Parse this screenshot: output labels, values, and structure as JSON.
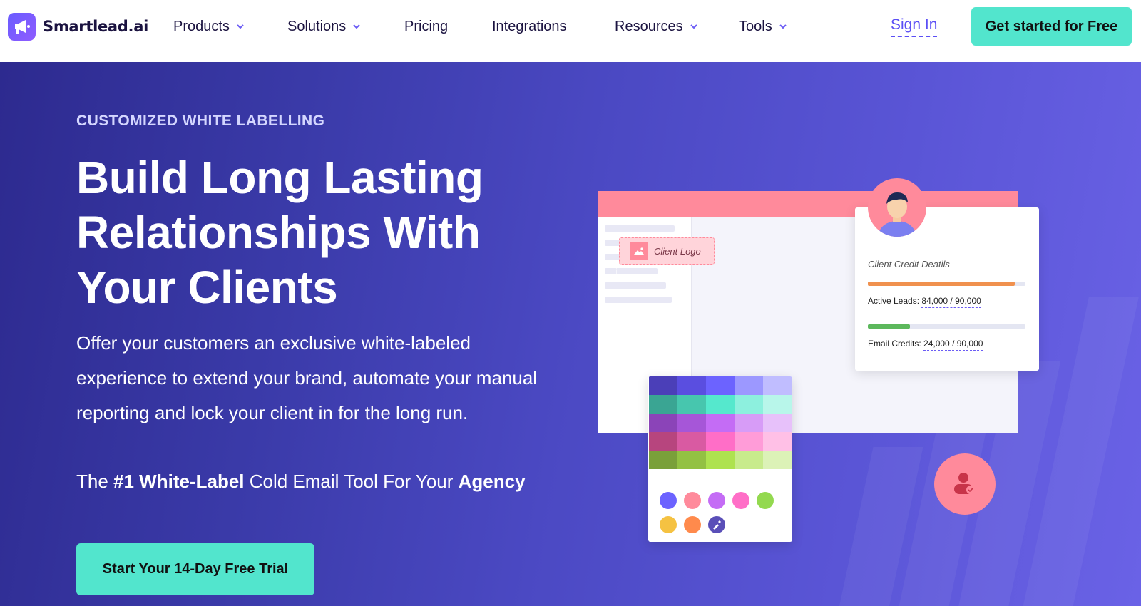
{
  "nav": {
    "brand": "Smartlead.ai",
    "items": [
      {
        "label": "Products",
        "dropdown": true
      },
      {
        "label": "Solutions",
        "dropdown": true
      },
      {
        "label": "Pricing",
        "dropdown": false
      },
      {
        "label": "Integrations",
        "dropdown": false
      },
      {
        "label": "Resources",
        "dropdown": true
      },
      {
        "label": "Tools",
        "dropdown": true
      }
    ],
    "sign_in": "Sign In",
    "cta": "Get started for Free"
  },
  "hero": {
    "eyebrow": "CUSTOMIZED WHITE LABELLING",
    "headline": "Build Long Lasting Relationships With Your Clients",
    "description": "Offer your customers an exclusive white-labeled experience to extend your brand, automate your manual reporting and lock your client in for the long run.",
    "tagline": {
      "prefix": "The ",
      "strong1": "#1 White-Label",
      "middle": " Cold Email Tool For Your ",
      "strong2": "Agency"
    },
    "cta": "Start Your 14-Day Free Trial"
  },
  "illustration": {
    "client_logo_label": "Client Logo",
    "card": {
      "title": "Client Credit Deatils",
      "active_leads_label": "Active Leads:",
      "active_leads_value": "84,000 / 90,000",
      "active_leads_fraction": 0.933,
      "email_credits_label": "Email Credits:",
      "email_credits_value": "24,000 / 90,000",
      "email_credits_fraction": 0.267
    },
    "swatches": [
      [
        "#4b3fb8",
        "#5a4ee0",
        "#6c63ff",
        "#9c98ff",
        "#c0bdff"
      ],
      [
        "#3aa593",
        "#47c6ae",
        "#55e8cd",
        "#8df0de",
        "#b8f6ea"
      ],
      [
        "#8b44b8",
        "#a656d8",
        "#c46cf5",
        "#d79cf7",
        "#e7c1fa"
      ],
      [
        "#b7457e",
        "#d95aa2",
        "#ff6ec7",
        "#ff9cd8",
        "#ffc0e6"
      ],
      [
        "#7aa03a",
        "#93c143",
        "#aee24f",
        "#c8eb8c",
        "#dcf2b7"
      ]
    ],
    "dots": [
      "#6c63ff",
      "#ff8a9b",
      "#c46cf5",
      "#ff6ec7",
      "#93d94f",
      "#f5c242",
      "#ff8a4c",
      "#5a4fb8"
    ],
    "colors": {
      "accent": "#52e5cd",
      "pink": "#ff8a9b",
      "bar_orange": "#f0914e",
      "bar_green": "#5cb85c"
    }
  }
}
